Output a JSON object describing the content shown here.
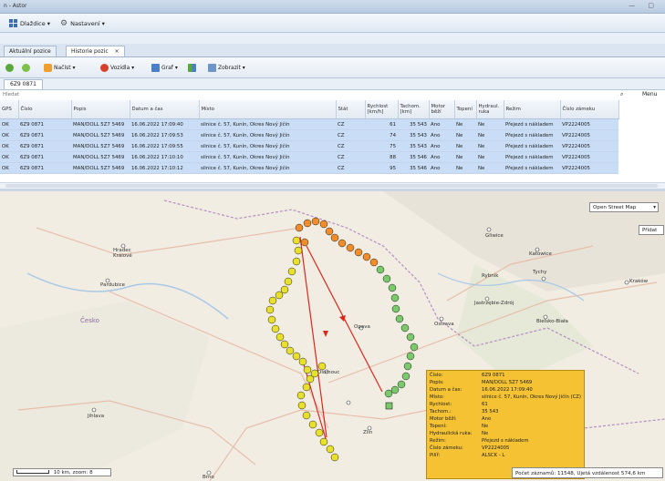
{
  "window": {
    "title": "n - Astor",
    "controls": "— ▢"
  },
  "menubar": {
    "items": [
      {
        "label": "Dlaždice ▾",
        "icon": "tiles-icon"
      },
      {
        "label": "Nastavení ▾",
        "icon": "gear-icon"
      }
    ]
  },
  "tabs": [
    {
      "label": "Aktuální pozice",
      "active": false
    },
    {
      "label": "Historie pozic",
      "active": true,
      "close": "×"
    }
  ],
  "toolbar": {
    "refresh_label": "",
    "add_label": "",
    "load_label": "Načíst ▾",
    "vehicles_label": "Vozidla ▾",
    "chart_label": "Graf ▾",
    "split_label": "",
    "show_label": "Zobrazit ▾"
  },
  "vehicle_tab": "6Z9 0871",
  "search": {
    "placeholder": "Hledat",
    "menu_label": "Menu"
  },
  "table": {
    "columns": [
      "GPS",
      "Číslo",
      "Popis",
      "Datum a čas",
      "Místo",
      "Stát",
      "Rychlost [km/h]",
      "Tachom. [km]",
      "Motor běží",
      "Topení",
      "Hydraul. ruka",
      "Režim",
      "Číslo zámeku"
    ],
    "rows": [
      [
        "OK",
        "6Z9 0871",
        "MAN/DOLL 5Z7 5469",
        "16.06.2022 17:09:40",
        "silnice č. 57, Kunín, Okres Nový Jičín",
        "CZ",
        "61",
        "35 543",
        "Ano",
        "Ne",
        "Ne",
        "Přejezd s nákladem",
        "VP2224005"
      ],
      [
        "OK",
        "6Z9 0871",
        "MAN/DOLL 5Z7 5469",
        "16.06.2022 17:09:53",
        "silnice č. 57, Kunín, Okres Nový Jičín",
        "CZ",
        "74",
        "35 543",
        "Ano",
        "Ne",
        "Ne",
        "Přejezd s nákladem",
        "VP2224005"
      ],
      [
        "OK",
        "6Z9 0871",
        "MAN/DOLL 5Z7 5469",
        "16.06.2022 17:09:55",
        "silnice č. 57, Kunín, Okres Nový Jičín",
        "CZ",
        "75",
        "35 543",
        "Ano",
        "Ne",
        "Ne",
        "Přejezd s nákladem",
        "VP2224005"
      ],
      [
        "OK",
        "6Z9 0871",
        "MAN/DOLL 5Z7 5469",
        "16.06.2022 17:10:10",
        "silnice č. 57, Kunín, Okres Nový Jičín",
        "CZ",
        "88",
        "35 546",
        "Ano",
        "Ne",
        "Ne",
        "Přejezd s nákladem",
        "VP2224005"
      ],
      [
        "OK",
        "6Z9 0871",
        "MAN/DOLL 5Z7 5469",
        "16.06.2022 17:10:12",
        "silnice č. 57, Kunín, Okres Nový Jičín",
        "CZ",
        "95",
        "35 546",
        "Ano",
        "Ne",
        "Ne",
        "Přejezd s nákladem",
        "VP2224005"
      ]
    ]
  },
  "map": {
    "type_select": "Open Street Map",
    "type_arrow": "▾",
    "button": "Přidat",
    "scale": "10 km, zoom: 8",
    "labels": {
      "hradec": "Hradec Králové",
      "pardubice": "Pardubice",
      "cesko": "Česko",
      "jihlava": "Jihlava",
      "brno": "Brno",
      "zlin": "Zlín",
      "ostrava": "Ostrava",
      "rybnik": "Rybnik",
      "tychy": "Tychy",
      "katowice": "Katowice",
      "gliwice": "Gliwice",
      "jastrzebie": "Jastrzębie-Zdrój",
      "bielsko": "Bielsko-Biała",
      "krakow": "Kraków",
      "olomouc": "Olomouc",
      "opava": "Opava"
    },
    "colors": {
      "yellow": "#e8e02a",
      "orange": "#f08c2a",
      "green": "#7ac96a",
      "route": "#e0261c"
    }
  },
  "popup": {
    "rows": [
      {
        "k": "Číslo:",
        "v": "6Z9 0871"
      },
      {
        "k": "Popis:",
        "v": "MAN/DOLL 5Z7 5469"
      },
      {
        "k": "Datum a čas:",
        "v": "16.06.2022 17:09:40"
      },
      {
        "k": "Místo:",
        "v": "silnice č. 57, Kunín, Okres Nový Jičín (CZ)"
      },
      {
        "k": "Rychlost:",
        "v": "61"
      },
      {
        "k": "Tachom.:",
        "v": "35 543"
      },
      {
        "k": "Motor běží:",
        "v": "Ano"
      },
      {
        "k": "Topení:",
        "v": "Ne"
      },
      {
        "k": "Hydraulická ruka:",
        "v": "Ne"
      },
      {
        "k": "Režim:",
        "v": "Přejezd s nákladem"
      },
      {
        "k": "Číslo zámeku:",
        "v": "VP2224005"
      },
      {
        "k": "Pilíř:",
        "v": "ALSCK - L"
      }
    ]
  },
  "status": "Počet záznamů: 11548, Ujetá vzdálenost 574,6 km"
}
